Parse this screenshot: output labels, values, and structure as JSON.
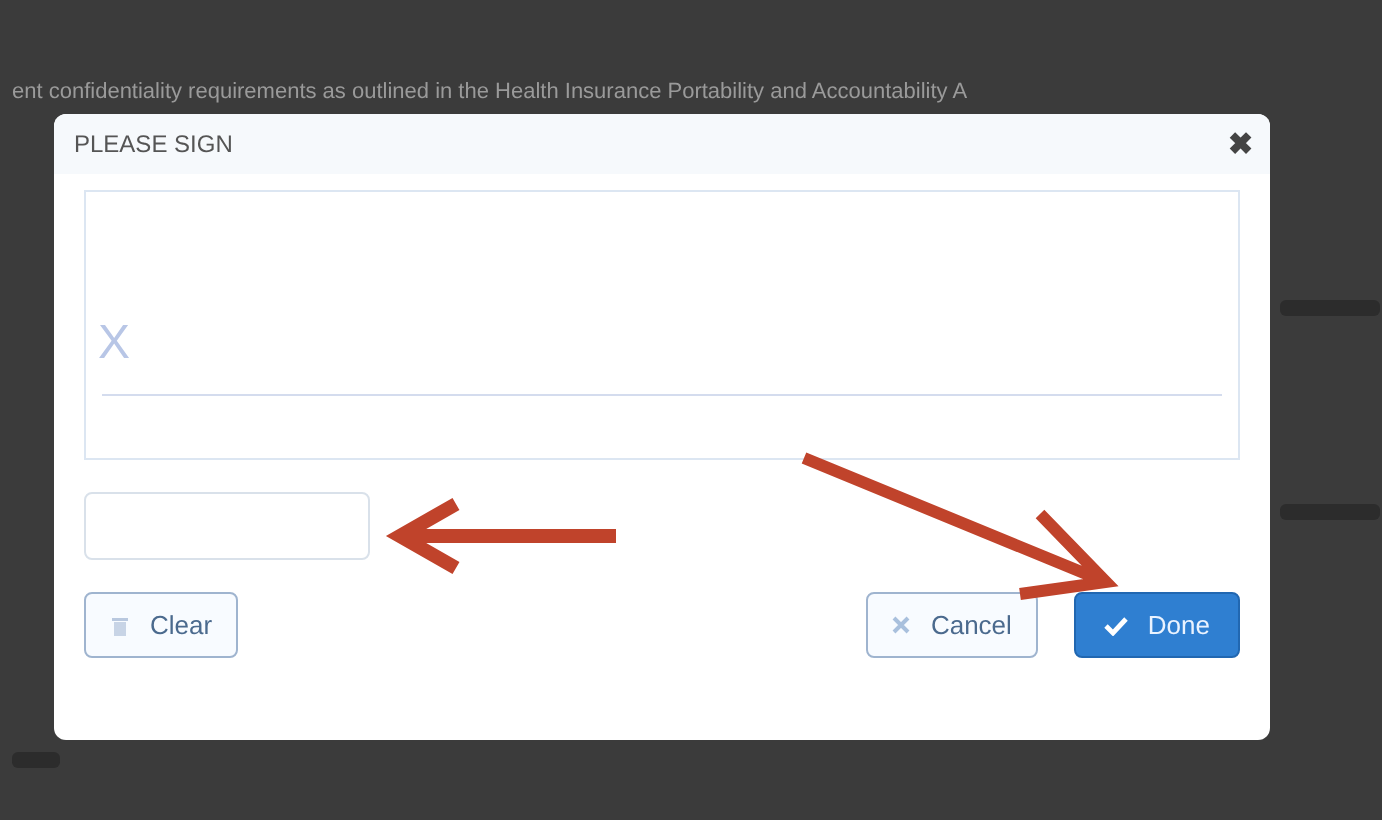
{
  "background_text": "ent confidentiality requirements as outlined in the Health Insurance Portability and Accountability A",
  "dialog": {
    "title": "PLEASE SIGN",
    "close": "✖",
    "signature_mark": "X",
    "buttons": [
      {
        "kind": "clear",
        "label": "Clear"
      },
      {
        "kind": "cancel",
        "label": "Cancel"
      },
      {
        "kind": "done",
        "label": "Done"
      }
    ]
  }
}
